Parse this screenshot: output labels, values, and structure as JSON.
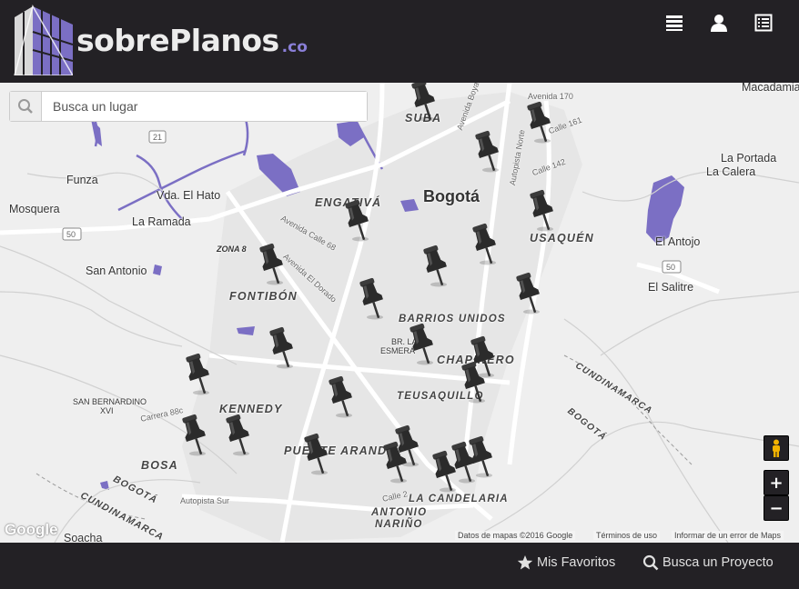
{
  "header": {
    "logo_text": "sobrePlanos",
    "logo_tld": ".co",
    "icons": [
      "menu-list-icon",
      "user-icon",
      "document-list-icon"
    ]
  },
  "search": {
    "placeholder": "Busca un lugar",
    "value": ""
  },
  "map": {
    "labels": {
      "suba": "SUBA",
      "bogota": "Bogotá",
      "engativa": "ENGATIVÁ",
      "usaquen": "USAQUÉN",
      "funza": "Funza",
      "mosquera": "Mosquera",
      "vda_el_hato": "Vda. El Hato",
      "la_ramada": "La Ramada",
      "san_antonio": "San Antonio",
      "zona8": "ZONA 8",
      "fontibon": "FONTIBÓN",
      "barrios_unidos": "BARRIOS UNIDOS",
      "br_la_esmeralda": "BR. LA",
      "esmeralda": "ESMERA",
      "chapinero": "CHAPINERO",
      "teusaquillo": "TEUSAQUILLO",
      "kennedy": "KENNEDY",
      "san_bernardino": "SAN BERNARDINO",
      "xvi": "XVI",
      "puente_aranda": "PUENTE ARANDA",
      "bosa": "BOSA",
      "bogota_region": "BOGOTÁ",
      "cundinamarca": "CUNDINAMARCA",
      "la_candelaria": "LA CANDELARIA",
      "antonio": "ANTONIO",
      "narino": "NARIÑO",
      "soacha": "Soacha",
      "macadamia": "Macadamia",
      "la_portada": "La Portada",
      "la_calera": "La Calera",
      "el_antojo": "El Antojo",
      "el_salitre": "El Salitre",
      "cundinamarca_east": "CUNDINAMARCA",
      "bogota_east": "BOGOTÁ",
      "avenida_170": "Avenida 170",
      "calle_161": "Calle 161",
      "calle_142": "Calle 142",
      "route_21": "21",
      "route_50_w": "50",
      "route_50_e": "50",
      "carrera_88c": "Carrera 88c",
      "autopista_sur": "Autopista Sur",
      "calle_2": "Calle 2",
      "avenida_boyaca": "Avenida Boyacá",
      "avenida_el_dorado": "Avenida El Dorado",
      "avenida_calle_68": "Avenida Calle 68",
      "avenida_norte": "Autopista Norte"
    },
    "google_logo": "Google",
    "attribution": {
      "data": "Datos de mapas ©2016 Google",
      "terms": "Términos de uso",
      "report": "Informar de un error de Maps"
    },
    "pins_count": 24,
    "accent_water": "#7b6fc4"
  },
  "controls": {
    "pegman": "pegman-icon",
    "zoom_in": "+",
    "zoom_out": "−"
  },
  "footer": {
    "favorites_label": "Mis Favoritos",
    "search_project_label": "Busca un Proyecto"
  },
  "colors": {
    "header_bg": "#232125",
    "brand_purple": "#7b6fc4",
    "map_bg": "#efefef"
  }
}
